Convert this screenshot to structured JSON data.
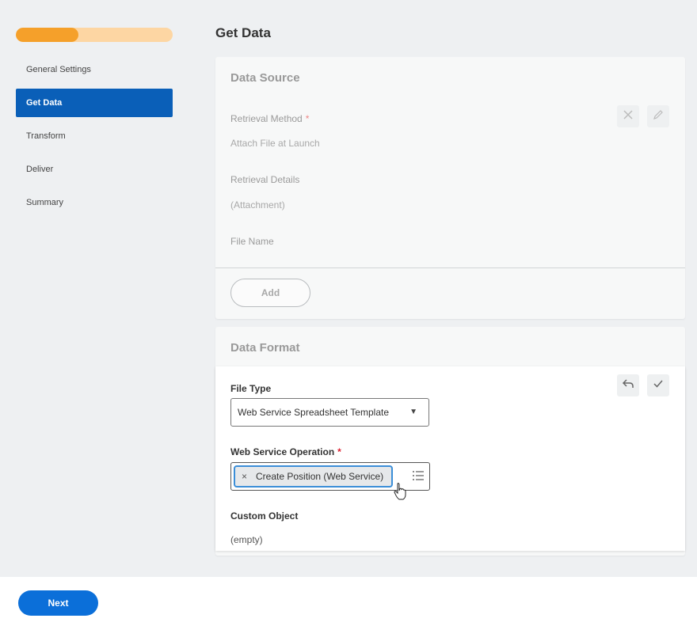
{
  "sidebar": {
    "progress": 0.4,
    "steps": [
      {
        "label": "General Settings"
      },
      {
        "label": "Get Data"
      },
      {
        "label": "Transform"
      },
      {
        "label": "Deliver"
      },
      {
        "label": "Summary"
      }
    ],
    "active_step": "Get Data"
  },
  "page": {
    "title": "Get Data"
  },
  "data_source": {
    "title": "Data Source",
    "retrieval_method_label": "Retrieval Method",
    "required_mark": "*",
    "retrieval_method_value": "Attach File at Launch",
    "retrieval_details_label": "Retrieval Details",
    "retrieval_details_value": "(Attachment)",
    "file_name_label": "File Name",
    "add_label": "Add",
    "icons": [
      "close-icon",
      "pencil-icon"
    ]
  },
  "data_format": {
    "title": "Data Format",
    "file_type_label": "File Type",
    "file_type_value": "Web Service Spreadsheet Template",
    "web_service_operation_label": "Web Service Operation",
    "required_mark": "*",
    "web_service_operation_value": "Create Position (Web Service)",
    "pill_remove": "×",
    "custom_object_label": "Custom Object",
    "custom_object_value": "(empty)",
    "icons": [
      "undo-icon",
      "check-icon",
      "list-icon",
      "hand-cursor-icon"
    ]
  },
  "footer": {
    "next_label": "Next"
  },
  "colors": {
    "accent": "#0a5fb8",
    "button": "#0b6fd9",
    "progress_fill": "#f5a02a",
    "progress_track": "#fdd6a3",
    "required": "#d22233"
  }
}
